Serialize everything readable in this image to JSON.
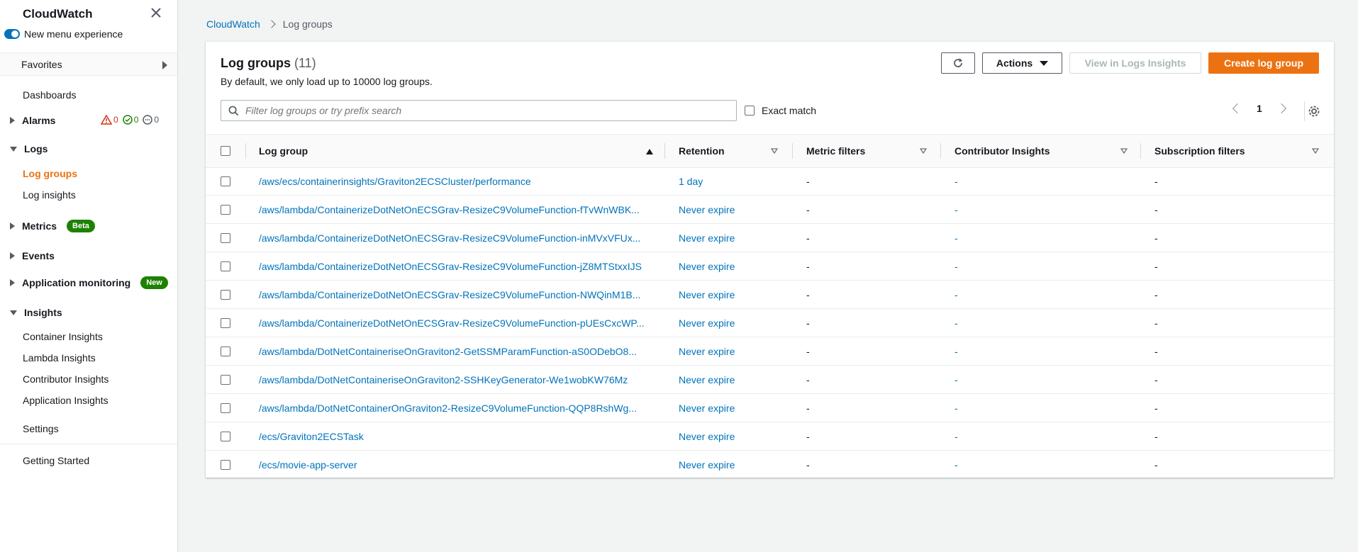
{
  "sidebar": {
    "title": "CloudWatch",
    "toggle_label": "New menu experience",
    "favorites_label": "Favorites",
    "dashboards": "Dashboards",
    "alarms": {
      "label": "Alarms",
      "alarm_count": "0",
      "ok_count": "0",
      "insufficient_count": "0"
    },
    "logs": {
      "label": "Logs",
      "items": [
        "Log groups",
        "Log insights"
      ]
    },
    "metrics": {
      "label": "Metrics",
      "badge": "Beta"
    },
    "events": {
      "label": "Events"
    },
    "application_monitoring": {
      "label": "Application monitoring",
      "badge": "New"
    },
    "insights": {
      "label": "Insights",
      "items": [
        "Container Insights",
        "Lambda Insights",
        "Contributor Insights",
        "Application Insights"
      ]
    },
    "settings": "Settings",
    "getting_started": "Getting Started"
  },
  "breadcrumb": {
    "root": "CloudWatch",
    "current": "Log groups"
  },
  "panel": {
    "title": "Log groups",
    "count": "(11)",
    "description": "By default, we only load up to 10000 log groups.",
    "actions_label": "Actions",
    "view_insights_label": "View in Logs Insights",
    "create_label": "Create log group",
    "search_placeholder": "Filter log groups or try prefix search",
    "exact_match_label": "Exact match",
    "page_number": "1"
  },
  "table": {
    "columns": [
      "Log group",
      "Retention",
      "Metric filters",
      "Contributor Insights",
      "Subscription filters"
    ],
    "rows": [
      {
        "name": "/aws/ecs/containerinsights/Graviton2ECSCluster/performance",
        "retention": "1 day",
        "metric": "-",
        "contrib": "-",
        "sub": "-"
      },
      {
        "name": "/aws/lambda/ContainerizeDotNetOnECSGrav-ResizeC9VolumeFunction-fTvWnWBK...",
        "retention": "Never expire",
        "metric": "-",
        "contrib": "-",
        "sub": "-"
      },
      {
        "name": "/aws/lambda/ContainerizeDotNetOnECSGrav-ResizeC9VolumeFunction-inMVxVFUx...",
        "retention": "Never expire",
        "metric": "-",
        "contrib": "-",
        "sub": "-"
      },
      {
        "name": "/aws/lambda/ContainerizeDotNetOnECSGrav-ResizeC9VolumeFunction-jZ8MTStxxIJS",
        "retention": "Never expire",
        "metric": "-",
        "contrib": "-",
        "sub": "-"
      },
      {
        "name": "/aws/lambda/ContainerizeDotNetOnECSGrav-ResizeC9VolumeFunction-NWQinM1B...",
        "retention": "Never expire",
        "metric": "-",
        "contrib": "-",
        "sub": "-"
      },
      {
        "name": "/aws/lambda/ContainerizeDotNetOnECSGrav-ResizeC9VolumeFunction-pUEsCxcWP...",
        "retention": "Never expire",
        "metric": "-",
        "contrib": "-",
        "sub": "-"
      },
      {
        "name": "/aws/lambda/DotNetContaineriseOnGraviton2-GetSSMParamFunction-aS0ODebO8...",
        "retention": "Never expire",
        "metric": "-",
        "contrib": "-",
        "sub": "-"
      },
      {
        "name": "/aws/lambda/DotNetContaineriseOnGraviton2-SSHKeyGenerator-We1wobKW76Mz",
        "retention": "Never expire",
        "metric": "-",
        "contrib": "-",
        "sub": "-"
      },
      {
        "name": "/aws/lambda/DotNetContainerOnGraviton2-ResizeC9VolumeFunction-QQP8RshWg...",
        "retention": "Never expire",
        "metric": "-",
        "contrib": "-",
        "sub": "-"
      },
      {
        "name": "/ecs/Graviton2ECSTask",
        "retention": "Never expire",
        "metric": "-",
        "contrib": "-",
        "sub": "-"
      },
      {
        "name": "/ecs/movie-app-server",
        "retention": "Never expire",
        "metric": "-",
        "contrib": "-",
        "sub": "-"
      }
    ]
  },
  "colors": {
    "accent": "#ec7211",
    "link": "#0073bb",
    "success": "#1d8102",
    "error": "#d13212"
  }
}
